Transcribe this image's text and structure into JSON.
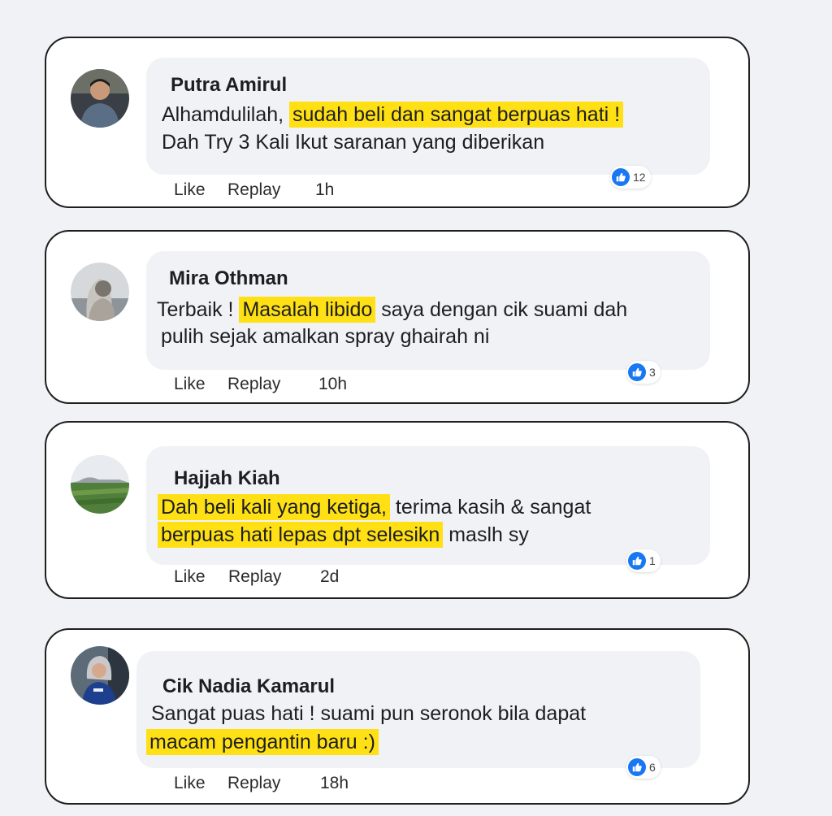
{
  "comments": [
    {
      "name": "Putra Amirul",
      "line1_plain": "Alhamdulilah, ",
      "line1_highlight": "sudah beli dan sangat berpuas hati !",
      "line2_plain": "Dah Try 3 Kali Ikut saranan yang diberikan",
      "like_label": "Like",
      "reply_label": "Replay",
      "time": "1h",
      "reaction_count": "12",
      "reaction_icon": "thumbs-up-icon"
    },
    {
      "name": "Mira Othman",
      "line1_pre": "Terbaik ! ",
      "line1_highlight": "Masalah libido",
      "line1_post": " saya dengan cik suami dah",
      "line2_plain": "pulih sejak amalkan spray ghairah ni",
      "like_label": "Like",
      "reply_label": "Replay",
      "time": "10h",
      "reaction_count": "3",
      "reaction_icon": "thumbs-up-icon"
    },
    {
      "name": "Hajjah Kiah",
      "line1_highlight": "Dah beli kali yang ketiga,",
      "line1_post": " terima kasih & sangat",
      "line2_highlight": "berpuas hati lepas dpt selesikn",
      "line2_post": " maslh sy",
      "like_label": "Like",
      "reply_label": "Replay",
      "time": "2d",
      "reaction_count": "1",
      "reaction_icon": "thumbs-up-icon"
    },
    {
      "name": "Cik Nadia Kamarul",
      "line1_plain": "Sangat puas hati ! suami pun seronok bila dapat",
      "line2_highlight": "macam pengantin baru :)",
      "like_label": "Like",
      "reply_label": "Replay",
      "time": "18h",
      "reaction_count": "6",
      "reaction_icon": "thumbs-up-icon"
    }
  ],
  "colors": {
    "highlight": "#ffe014",
    "like_blue": "#1877f2",
    "bubble": "#f0f2f5",
    "page_background": "#f0f2f6"
  }
}
